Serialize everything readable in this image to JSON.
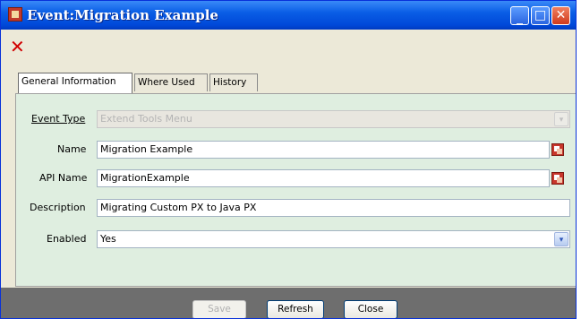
{
  "window": {
    "title": "Event:Migration Example",
    "minimize_glyph": "_",
    "maximize_glyph": "□",
    "close_glyph": "✕"
  },
  "toolbar": {
    "delete_glyph": "✕"
  },
  "tabs": [
    {
      "label": "General Information",
      "active": true
    },
    {
      "label": "Where Used",
      "active": false
    },
    {
      "label": "History",
      "active": false
    }
  ],
  "form": {
    "event_type": {
      "label": "Event Type",
      "value": "Extend Tools Menu",
      "enabled": false
    },
    "name": {
      "label": "Name",
      "value": "Migration Example"
    },
    "api_name": {
      "label": "API Name",
      "value": "MigrationExample"
    },
    "description": {
      "label": "Description",
      "value": "Migrating Custom PX to Java PX"
    },
    "enabled": {
      "label": "Enabled",
      "value": "Yes"
    }
  },
  "buttons": {
    "save": "Save",
    "refresh": "Refresh",
    "close": "Close"
  },
  "icons": {
    "combo_arrow": "▾",
    "translate": "translate-icon"
  },
  "colors": {
    "titlebar": "#0a5ee6",
    "panel": "#dfeee0",
    "delete": "#d10000"
  }
}
